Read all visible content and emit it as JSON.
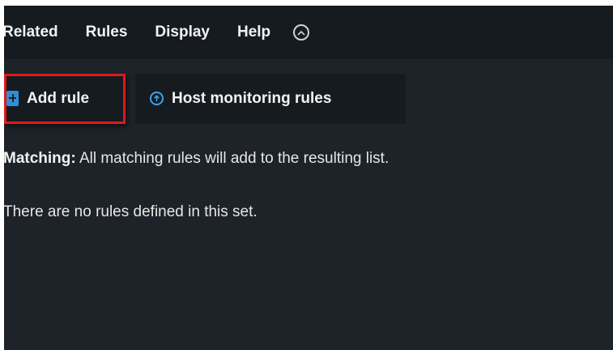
{
  "menu": {
    "items": [
      {
        "label": "Related"
      },
      {
        "label": "Rules"
      },
      {
        "label": "Display"
      },
      {
        "label": "Help"
      }
    ],
    "collapse_icon": "chevron-up-circle-icon"
  },
  "toolbar": {
    "add_rule_label": "Add rule",
    "add_rule_icon": "add-icon",
    "host_rules_label": "Host monitoring rules",
    "host_rules_icon": "arrow-up-circle-icon"
  },
  "content": {
    "matching_label": "Matching:",
    "matching_text": "All matching rules will add to the resulting list.",
    "empty_text": "There are no rules defined in this set."
  },
  "colors": {
    "background": "#1e2329",
    "bar": "#161b20",
    "highlight": "#e01818",
    "accent": "#2d8fd6"
  }
}
